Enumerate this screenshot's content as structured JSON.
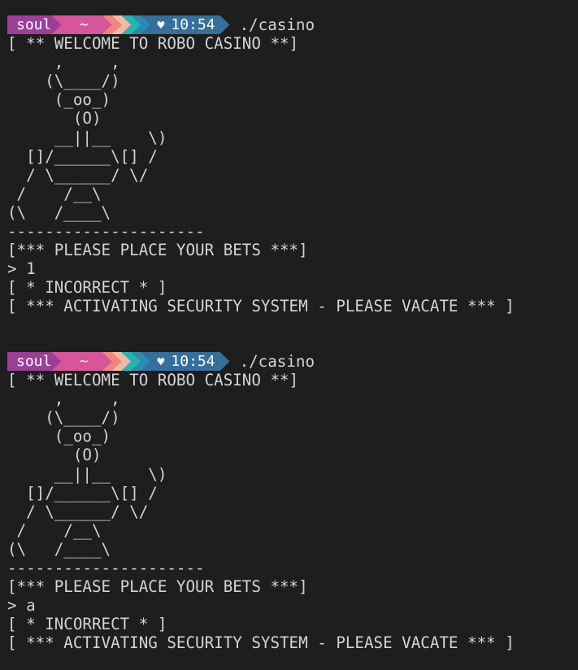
{
  "prompt": {
    "user": "soul",
    "dir": "~",
    "heart_icon": "heart-icon",
    "time": "10:54",
    "command": "./casino",
    "colors": {
      "user_bg": "#9b3f9a",
      "dir_bg": "#d7559a",
      "chevrons": [
        "#f1857f",
        "#f4b8a4",
        "#26b6b1",
        "#2c8bb0"
      ],
      "time_bg": "#356f9b"
    }
  },
  "sessions": [
    {
      "welcome": "[ ** WELCOME TO ROBO CASINO **]",
      "robot": [
        "     ,     ,",
        "    (\\____/)",
        "     (_oo_)",
        "       (O)",
        "     __||__    \\)",
        "  []/______\\[] /",
        "  / \\______/ \\/",
        " /    /__\\",
        "(\\   /____\\",
        "---------------------"
      ],
      "bets_prompt": "[*** PLEASE PLACE YOUR BETS ***]",
      "input": "> 1",
      "result": "[ * INCORRECT * ]",
      "security": "[ *** ACTIVATING SECURITY SYSTEM - PLEASE VACATE *** ]"
    },
    {
      "welcome": "[ ** WELCOME TO ROBO CASINO **]",
      "robot": [
        "     ,     ,",
        "    (\\____/)",
        "     (_oo_)",
        "       (O)",
        "     __||__    \\)",
        "  []/______\\[] /",
        "  / \\______/ \\/",
        " /    /__\\",
        "(\\   /____\\",
        "---------------------"
      ],
      "bets_prompt": "[*** PLEASE PLACE YOUR BETS ***]",
      "input": "> a",
      "result": "[ * INCORRECT * ]",
      "security": "[ *** ACTIVATING SECURITY SYSTEM - PLEASE VACATE *** ]"
    }
  ]
}
